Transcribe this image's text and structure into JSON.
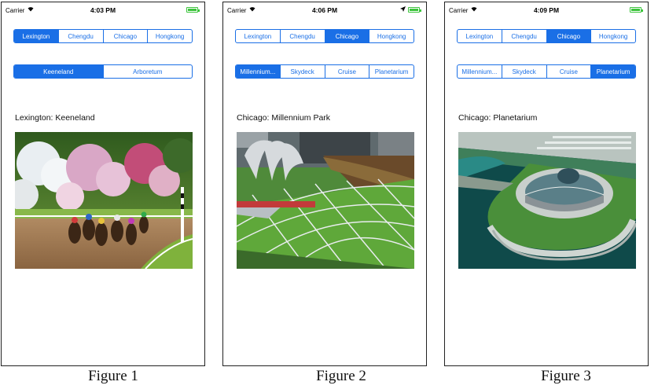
{
  "screens": [
    {
      "status": {
        "carrier": "Carrier",
        "time": "4:03 PM",
        "location_arrow": false
      },
      "cities": [
        "Lexington",
        "Chengdu",
        "Chicago",
        "Hongkong"
      ],
      "selected_city": 0,
      "places": [
        "Keeneland",
        "Arboretum"
      ],
      "selected_place": 0,
      "caption": "Lexington: Keeneland",
      "photo": "horse-racing-photo",
      "figure": "Figure 1"
    },
    {
      "status": {
        "carrier": "Carrier",
        "time": "4:06 PM",
        "location_arrow": true
      },
      "cities": [
        "Lexington",
        "Chengdu",
        "Chicago",
        "Hongkong"
      ],
      "selected_city": 2,
      "places": [
        "Millennium...",
        "Skydeck",
        "Cruise",
        "Planetarium"
      ],
      "selected_place": 0,
      "caption": "Chicago: Millennium Park",
      "photo": "millennium-park-photo",
      "figure": "Figure 2"
    },
    {
      "status": {
        "carrier": "Carrier",
        "time": "4:09 PM",
        "location_arrow": false
      },
      "cities": [
        "Lexington",
        "Chengdu",
        "Chicago",
        "Hongkong"
      ],
      "selected_city": 2,
      "places": [
        "Millennium...",
        "Skydeck",
        "Cruise",
        "Planetarium"
      ],
      "selected_place": 3,
      "caption": "Chicago: Planetarium",
      "photo": "planetarium-photo",
      "figure": "Figure 3"
    }
  ],
  "colors": {
    "accent": "#1a6fe6",
    "battery": "#3cc43c"
  }
}
